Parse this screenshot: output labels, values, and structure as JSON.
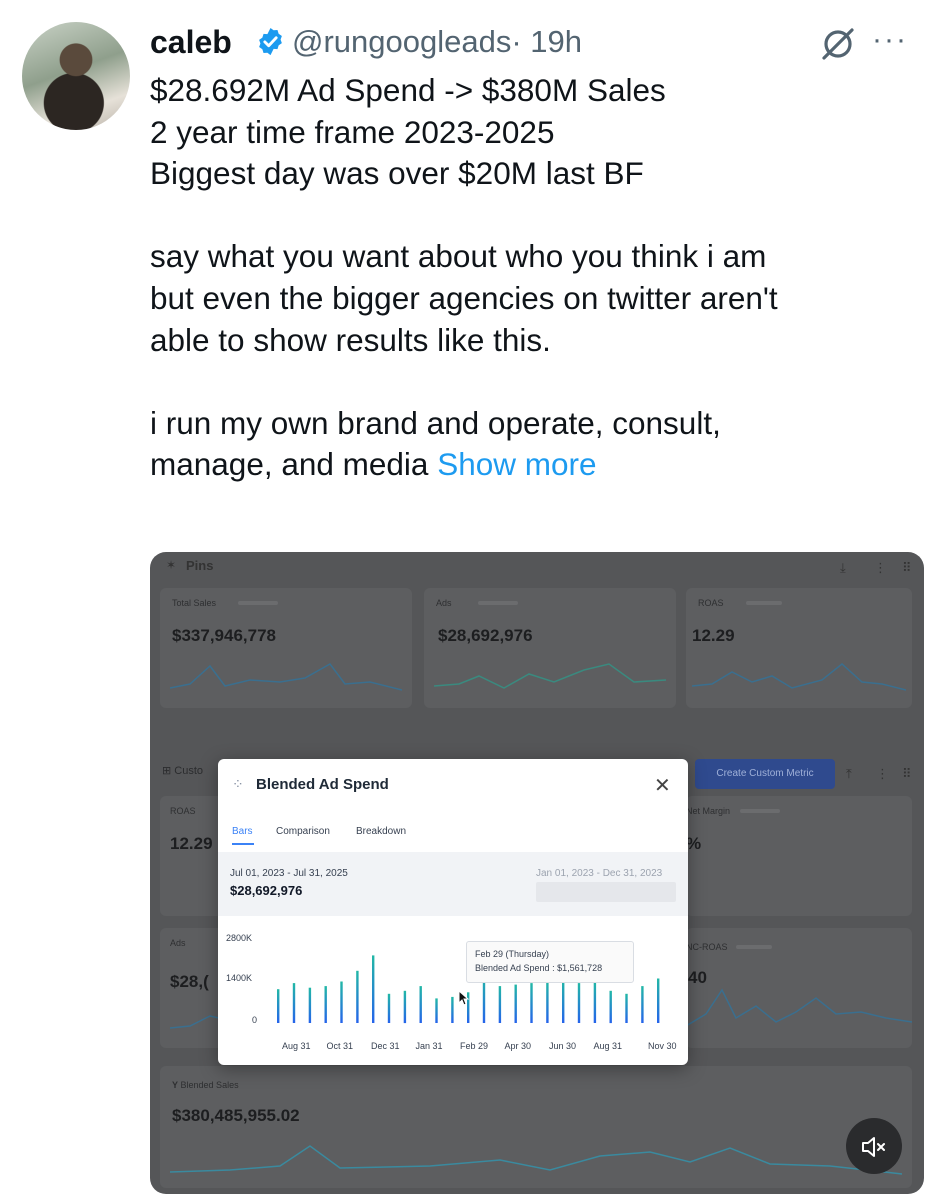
{
  "tweet": {
    "author_name": "caleb",
    "handle": "@rungoogleads",
    "time": "· 19h",
    "text": "$28.692M Ad Spend -> $380M Sales\n2 year time frame 2023-2025\nBiggest day was over $20M last BF\n\nsay what you want about who you think i am\nbut even the bigger agencies on twitter aren't\nable to show results like this.\n\ni run my own brand and operate, consult,\nmanage, and media ",
    "show_more": "Show more",
    "more_glyph": "···"
  },
  "dashboard": {
    "pins_label": "Pins",
    "cards": [
      {
        "label": "Total Sales",
        "value": "$337,946,778"
      },
      {
        "label": "Ads",
        "value": "$28,692,976"
      },
      {
        "label": "ROAS",
        "value": "12.29"
      }
    ],
    "custom_label": "Custo",
    "create_custom_metric": "Create Custom Metric",
    "left_cards": [
      {
        "label": "ROAS",
        "value": "12.29"
      },
      {
        "label": "Ads",
        "value": "$28,("
      }
    ],
    "right_cards": [
      {
        "label": "Net Margin",
        "value": "%"
      },
      {
        "label": "NC-ROAS",
        "value": "40"
      }
    ],
    "blended_sales_label": "Blended Sales",
    "blended_sales_value": "$380,485,955.02"
  },
  "modal": {
    "title": "Blended Ad Spend",
    "close_glyph": "✕",
    "tabs": [
      "Bars",
      "Comparison",
      "Breakdown"
    ],
    "range_primary": "Jul 01, 2023 - Jul 31, 2025",
    "range_primary_value": "$28,692,976",
    "range_compare": "Jan 01, 2023 - Dec 31, 2023",
    "tooltip_date": "Feb 29 (Thursday)",
    "tooltip_value": "Blended Ad Spend : $1,561,728"
  },
  "chart_data": {
    "type": "bar",
    "title": "Blended Ad Spend",
    "y_ticks": [
      "2800K",
      "1400K",
      "0"
    ],
    "ylim": [
      0,
      2800000
    ],
    "x_ticks": [
      "Aug 31",
      "Oct 31",
      "Dec 31",
      "Jan 31",
      "Feb 29",
      "Apr 30",
      "Jun 30",
      "Aug 31",
      "Nov 30"
    ],
    "values": [
      1100000,
      1300000,
      1150000,
      1200000,
      1350000,
      1700000,
      2200000,
      950000,
      1050000,
      1200000,
      800000,
      850000,
      1000000,
      1561728,
      1200000,
      1250000,
      1300000,
      1350000,
      1400000,
      1300000,
      1350000,
      1050000,
      950000,
      1200000,
      1450000
    ],
    "highlight_index": 13
  },
  "colors": {
    "link": "#1d9bf0",
    "verified": "#1d9bf0",
    "bar_top": "#22b8a6",
    "bar_bottom": "#2563eb",
    "modal_accent": "#3b82f6"
  }
}
